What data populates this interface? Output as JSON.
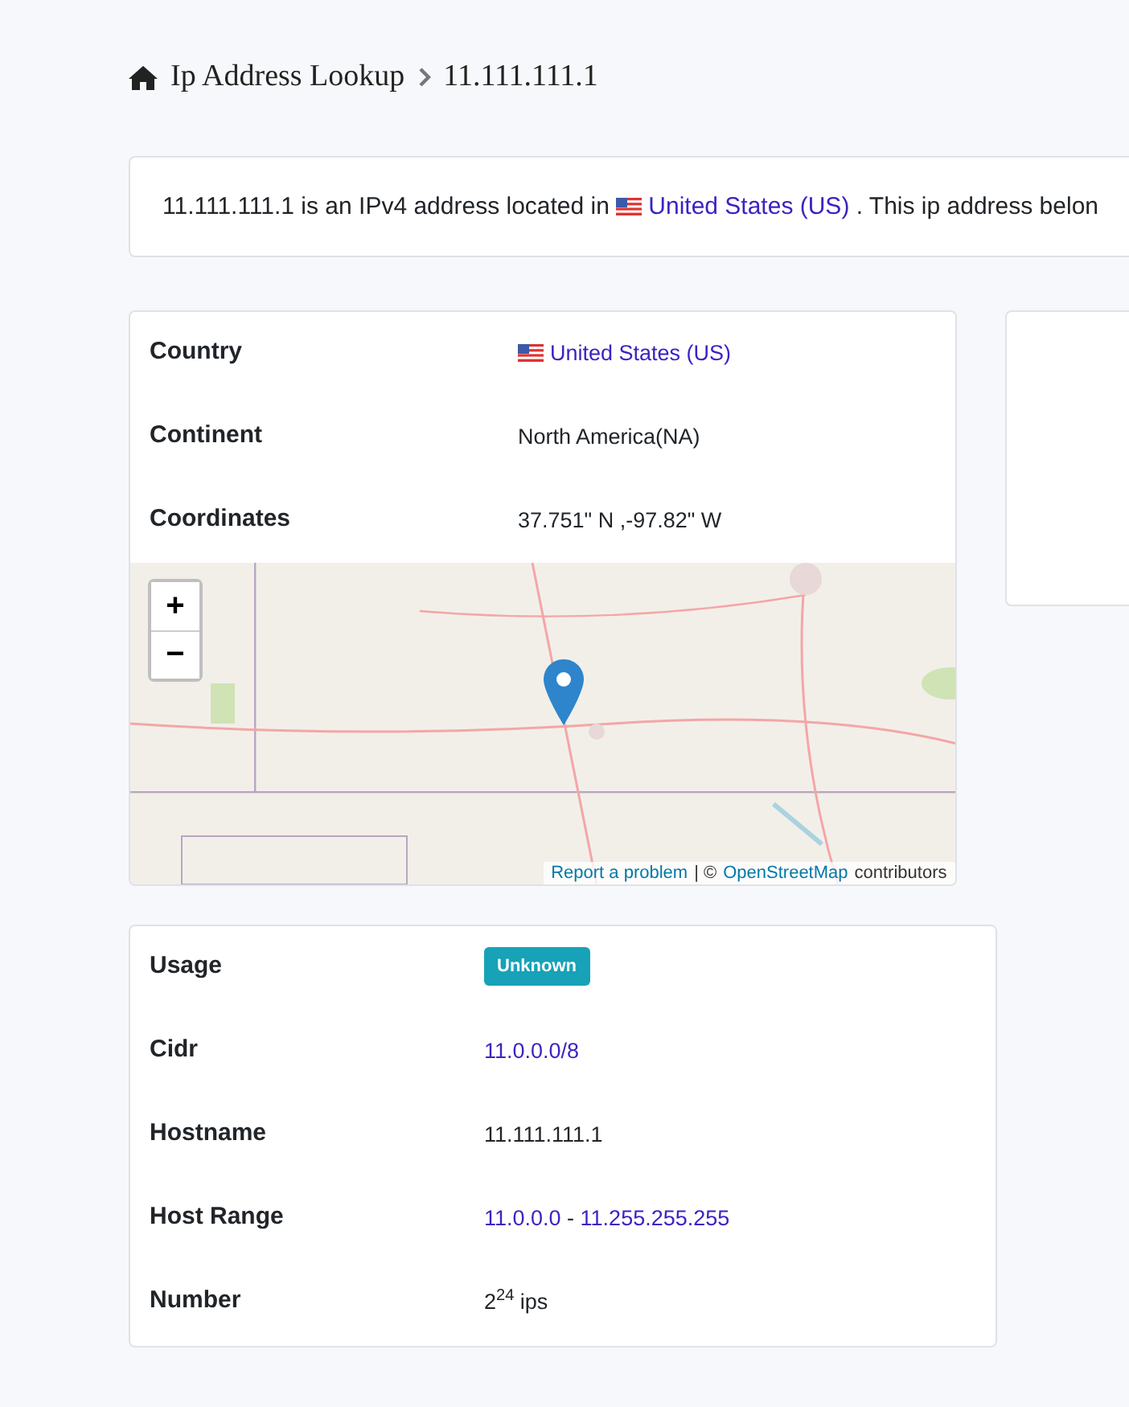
{
  "breadcrumb": {
    "home": "Ip Address Lookup",
    "current": "11.111.111.1"
  },
  "intro": {
    "before": "11.111.111.1 is an IPv4 address located in",
    "country_link": "United States (US)",
    "after": ". This ip address belon"
  },
  "location": {
    "rows": [
      {
        "label": "Country",
        "kind": "flag-link",
        "value": "United States (US)"
      },
      {
        "label": "Continent",
        "kind": "text",
        "value": "North America(NA)"
      },
      {
        "label": "Coordinates",
        "kind": "text",
        "value": "37.751\" N ,-97.82\" W"
      }
    ],
    "map": {
      "zoom_in": "+",
      "zoom_out": "−",
      "report_link": "Report a problem",
      "separator": "| ©",
      "osm_link": "OpenStreetMap",
      "contributors": "contributors"
    }
  },
  "network": {
    "rows": [
      {
        "label": "Usage",
        "kind": "badge",
        "value": "Unknown"
      },
      {
        "label": "Cidr",
        "kind": "link",
        "value": "11.0.0.0/8"
      },
      {
        "label": "Hostname",
        "kind": "text",
        "value": "11.111.111.1"
      },
      {
        "label": "Host Range",
        "kind": "range",
        "start": "11.0.0.0",
        "separator": " - ",
        "end": "11.255.255.255"
      },
      {
        "label": "Number",
        "kind": "rich",
        "value": "2$^{24}$ ips"
      }
    ]
  }
}
